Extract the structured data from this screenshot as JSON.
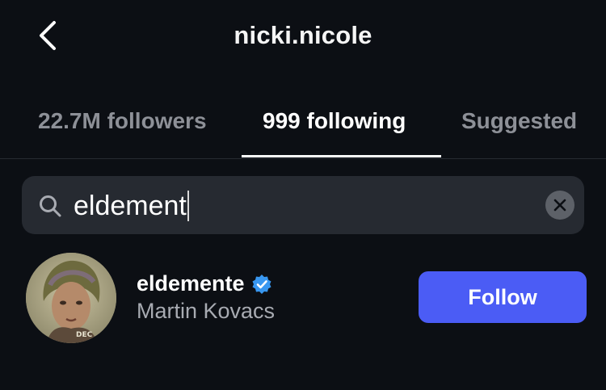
{
  "header": {
    "title": "nicki.nicole",
    "back_icon": "chevron-left-icon"
  },
  "tabs": [
    {
      "label": "22.7M followers",
      "active": false
    },
    {
      "label": "999 following",
      "active": true
    },
    {
      "label": "Suggested",
      "active": false
    }
  ],
  "search": {
    "icon": "search-icon",
    "value": "eldement",
    "clear_icon": "close-icon"
  },
  "results": [
    {
      "username": "eldemente",
      "verified": true,
      "full_name": "Martin Kovacs",
      "follow_label": "Follow",
      "avatar_badge": "DEC"
    }
  ],
  "colors": {
    "background": "#0c0f14",
    "accent": "#4b5cf5",
    "verified": "#3897f0",
    "search_bg": "#262a31"
  }
}
